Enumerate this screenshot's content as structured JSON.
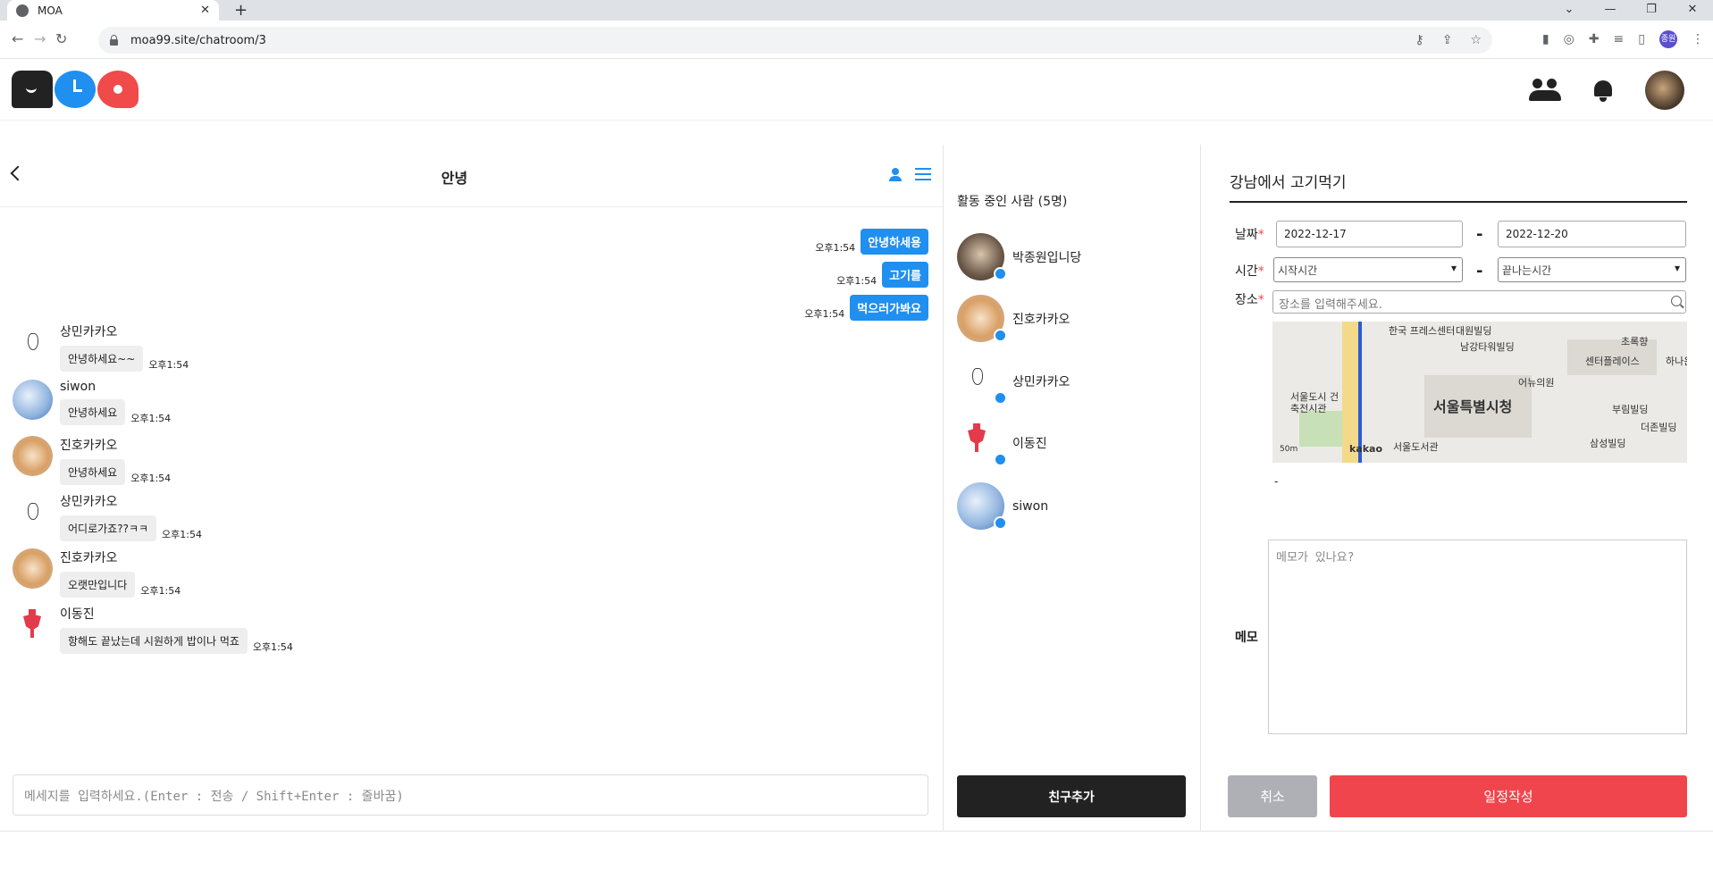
{
  "browser": {
    "tab_title": "MOA",
    "url": "moa99.site/chatroom/3",
    "profile_initial": "종원"
  },
  "chat": {
    "room_title": "안녕",
    "my_messages": [
      {
        "text": "안녕하세용",
        "time": "오후1:54"
      },
      {
        "text": "고기를",
        "time": "오후1:54"
      },
      {
        "text": "먹으러가봐요",
        "time": "오후1:54"
      }
    ],
    "other_messages": [
      {
        "name": "상민카카오",
        "text": "안녕하세요~~",
        "time": "오후1:54",
        "avatar": "sketch"
      },
      {
        "name": "siwon",
        "text": "안녕하세요",
        "time": "오후1:54",
        "avatar": "blue"
      },
      {
        "name": "진호카카오",
        "text": "안녕하세요",
        "time": "오후1:54",
        "avatar": "dog"
      },
      {
        "name": "상민카카오",
        "text": "어디로가죠??ㅋㅋ",
        "time": "오후1:54",
        "avatar": "sketch"
      },
      {
        "name": "진호카카오",
        "text": "오랫만입니다",
        "time": "오후1:54",
        "avatar": "dog"
      },
      {
        "name": "이동진",
        "text": "항해도 끝났는데 시원하게 밥이나 먹죠",
        "time": "오후1:54",
        "avatar": "red"
      }
    ],
    "input_placeholder": "메세지를 입력하세요.(Enter : 전송 / Shift+Enter : 줄바꿈)"
  },
  "people": {
    "title": "활동 중인 사람 (5명)",
    "list": [
      {
        "name": "박종원입니당",
        "avatar": "cat"
      },
      {
        "name": "진호카카오",
        "avatar": "dog"
      },
      {
        "name": "상민카카오",
        "avatar": "sketch"
      },
      {
        "name": "이동진",
        "avatar": "red"
      },
      {
        "name": "siwon",
        "avatar": "blue"
      }
    ],
    "add_friend_label": "친구추가"
  },
  "schedule": {
    "title": "강남에서 고기먹기",
    "date_label": "날짜",
    "time_label": "시간",
    "place_label": "장소",
    "required_mark": "*",
    "start_date": "2022-12-17",
    "end_date": "2022-12-20",
    "range_sep": "-",
    "start_time": "시작시간",
    "end_time": "끝나는시간",
    "place_placeholder": "장소를 입력해주세요.",
    "map_labels": {
      "city_hall": "서울특별시청",
      "plaza": "한국 프레스센터",
      "daewon": "대원빌딩",
      "namgang": "남강타워빌딩",
      "center": "센터플레이스",
      "hospital": "어뉴의원",
      "chorok": "초록향",
      "hanaeun": "하나은",
      "archi": "서울도시 건축전시관",
      "library": "서울도서관",
      "buryeong": "부림빌딩",
      "samsung": "삼성빌딩",
      "thejon": "더존빌딩",
      "scale": "50m",
      "brand": "kakao"
    },
    "dash_line": "-",
    "memo_label": "메모",
    "memo_placeholder": "메모가 있나요?",
    "cancel_label": "취소",
    "submit_label": "일정작성"
  },
  "colors": {
    "accent": "#1f8ff0",
    "danger": "#f0454c",
    "dark": "#222222"
  }
}
